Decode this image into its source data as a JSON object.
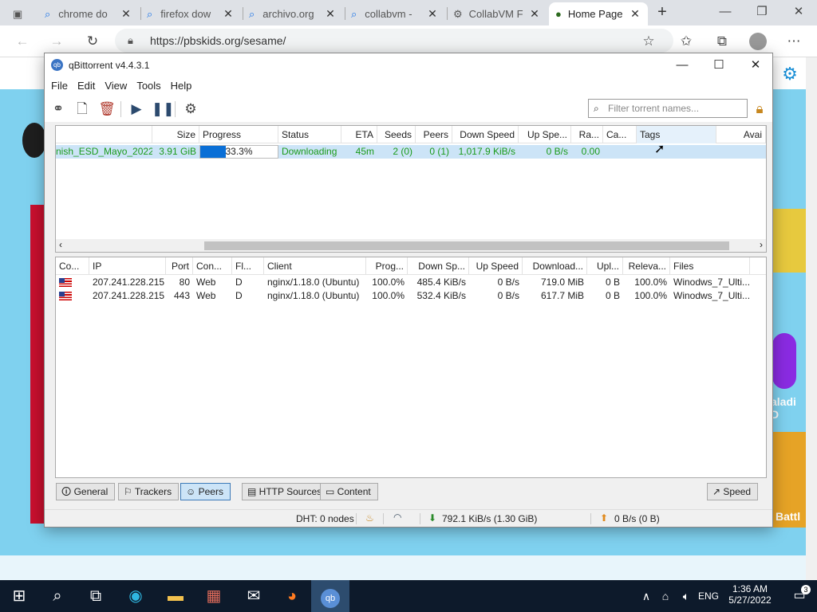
{
  "browser": {
    "tabs": [
      {
        "title": "chrome do",
        "icon": "search-icon",
        "active": false
      },
      {
        "title": "firefox dow",
        "icon": "search-icon",
        "active": false
      },
      {
        "title": "archivo.org",
        "icon": "search-icon",
        "active": false
      },
      {
        "title": "collabvm -",
        "icon": "search-icon",
        "active": false
      },
      {
        "title": "CollabVM F",
        "icon": "collabvm-icon",
        "active": false
      },
      {
        "title": "Home Page",
        "icon": "pbskids-icon",
        "active": true
      }
    ],
    "url": "https://pbskids.org/sesame/",
    "page_text": [
      "aladi D",
      "Battl"
    ]
  },
  "qbt": {
    "title": "qBittorrent v4.4.3.1",
    "menu": [
      "File",
      "Edit",
      "View",
      "Tools",
      "Help"
    ],
    "filter_placeholder": "Filter torrent names...",
    "torrent_columns": [
      "Size",
      "Progress",
      "Status",
      "ETA",
      "Seeds",
      "Peers",
      "Down Speed",
      "Up Spe...",
      "Ra...",
      "Ca...",
      "Tags",
      "Avai"
    ],
    "torrent": {
      "name": "nish_ESD_Mayo_2022",
      "size": "3.91 GiB",
      "progress": "33.3%",
      "progress_fraction": 0.333,
      "status": "Downloading",
      "eta": "45m",
      "seeds": "2 (0)",
      "peers": "0 (1)",
      "down_speed": "1,017.9 KiB/s",
      "up_speed": "0 B/s",
      "ratio": "0.00"
    },
    "peer_columns": [
      "Co...",
      "IP",
      "Port",
      "Con...",
      "Fl...",
      "Client",
      "Prog...",
      "Down Sp...",
      "Up Speed",
      "Download...",
      "Upl...",
      "Releva...",
      "Files"
    ],
    "peers": [
      {
        "ip": "207.241.228.215",
        "port": "80",
        "conn": "Web",
        "flags": "D",
        "client": "nginx/1.18.0 (Ubuntu)",
        "progress": "100.0%",
        "down": "485.4 KiB/s",
        "up": "0 B/s",
        "downloaded": "719.0 MiB",
        "uploaded": "0 B",
        "relevance": "100.0%",
        "files": "Winodws_7_Ulti..."
      },
      {
        "ip": "207.241.228.215",
        "port": "443",
        "conn": "Web",
        "flags": "D",
        "client": "nginx/1.18.0 (Ubuntu)",
        "progress": "100.0%",
        "down": "532.4 KiB/s",
        "up": "0 B/s",
        "downloaded": "617.7 MiB",
        "uploaded": "0 B",
        "relevance": "100.0%",
        "files": "Winodws_7_Ulti..."
      }
    ],
    "bottom_tabs": [
      "General",
      "Trackers",
      "Peers",
      "HTTP Sources",
      "Content"
    ],
    "speed_button": "Speed",
    "status": {
      "dht": "DHT: 0 nodes",
      "download": "792.1 KiB/s (1.30 GiB)",
      "upload": "0 B/s (0 B)"
    }
  },
  "taskbar": {
    "lang": "ENG",
    "time": "1:36 AM",
    "date": "5/27/2022",
    "notifications": "3"
  }
}
